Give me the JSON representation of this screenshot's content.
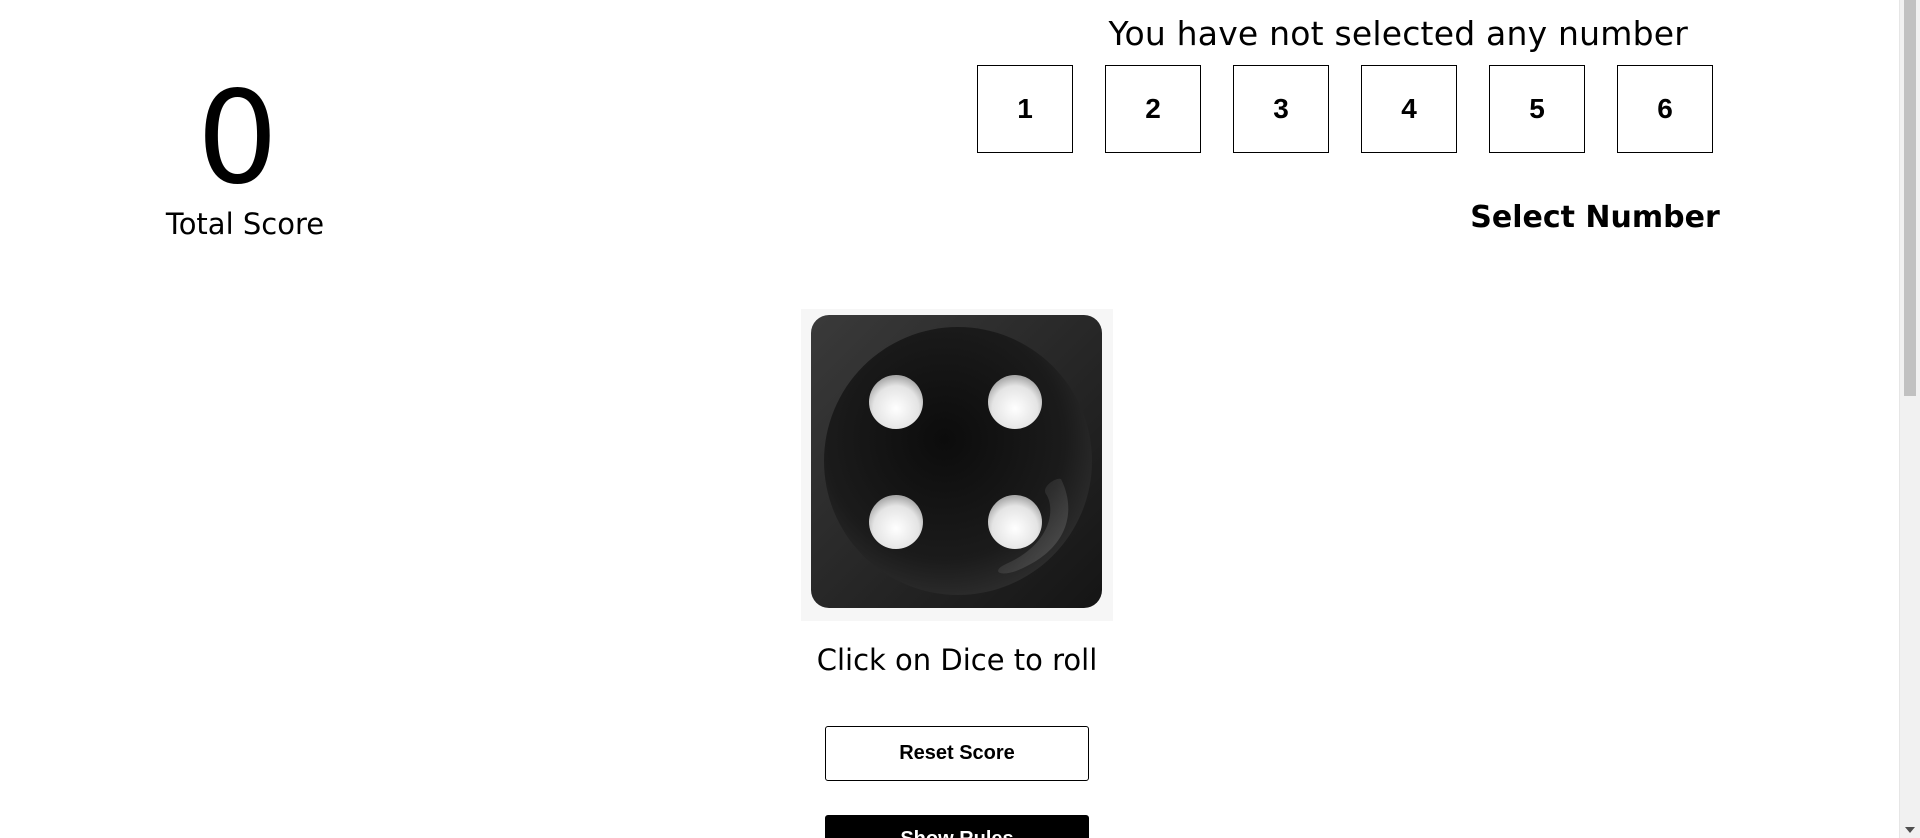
{
  "score": {
    "value": "0",
    "label": "Total Score"
  },
  "selector": {
    "message": "You have not selected any number",
    "numbers": [
      "1",
      "2",
      "3",
      "4",
      "5",
      "6"
    ],
    "heading": "Select Number"
  },
  "dice": {
    "face": 4,
    "icon": "dice-four-icon"
  },
  "roll_hint": "Click on Dice to roll",
  "buttons": {
    "reset_label": "Reset Score",
    "rules_label": "Show Rules"
  },
  "colors": {
    "dice_body": "#1a1a1a",
    "pip": "#ffffff",
    "rules_button_bg": "#000000"
  }
}
